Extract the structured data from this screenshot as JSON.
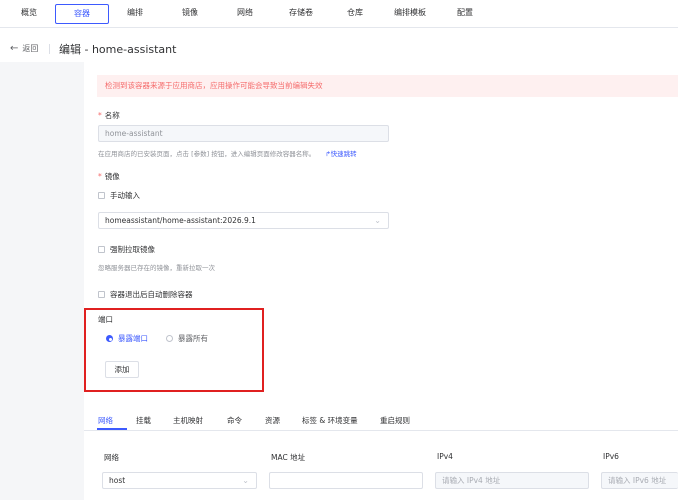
{
  "nav": {
    "tabs": [
      "概览",
      "容器",
      "编排",
      "镜像",
      "网络",
      "存储卷",
      "仓库",
      "编排模板",
      "配置"
    ],
    "active": "容器"
  },
  "header": {
    "back_label": "返回",
    "title": "编辑 - home-assistant"
  },
  "alert": {
    "text": "检测到该容器来源于应用商店，应用操作可能会导致当前编辑失效"
  },
  "form": {
    "name": {
      "label": "名称",
      "value": "home-assistant",
      "hint": "在应用商店的已安装页面，点击 [参数] 按钮，进入编辑页面修改容器名称。",
      "link": "快速跳转"
    },
    "image": {
      "label": "镜像",
      "manual_input_label": "手动输入",
      "value": "homeassistant/home-assistant:2026.9.1",
      "force_pull_label": "强制拉取镜像",
      "force_pull_hint": "忽略服务器已存在的镜像，重新拉取一次"
    },
    "auto_remove_label": "容器退出后自动删除容器",
    "ports": {
      "label": "端口",
      "expose_port_label": "暴露端口",
      "expose_all_label": "暴露所有",
      "selected": "暴露端口",
      "add_button": "添加"
    }
  },
  "bottom_tabs": {
    "tabs": [
      "网络",
      "挂载",
      "主机映射",
      "命令",
      "资源",
      "标签 & 环境变量",
      "重启规则"
    ],
    "active": "网络"
  },
  "network_table": {
    "headers": [
      "网络",
      "MAC 地址",
      "IPv4",
      "IPv6"
    ],
    "network_value": "host",
    "mac_value": "",
    "ipv4_placeholder": "请输入 IPv4 地址",
    "ipv6_placeholder": "请输入 IPv6 地址"
  },
  "colors": {
    "accent": "#3d5afe",
    "alert_bg": "#fef0f0",
    "alert_text": "#f56c6c",
    "highlight_border": "#e02020"
  }
}
